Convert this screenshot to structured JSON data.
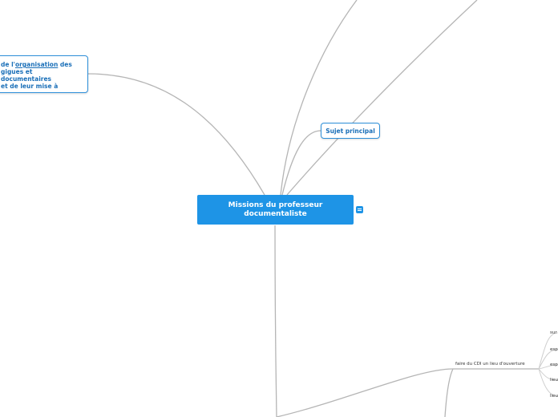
{
  "root": {
    "label_line1": "Missions du professeur",
    "label_line2": "documentaliste"
  },
  "left_node": {
    "line1_prefix": "de l'",
    "line1_link": "organisation",
    "line1_suffix": " des",
    "line2": "gigues et documentaires",
    "line3": "et de leur mise à"
  },
  "sujet": {
    "label": "Sujet principal"
  },
  "branch": {
    "label": "faire du CDI un lieu d'ouverture"
  },
  "leaves": [
    "sur",
    "esp",
    "esp",
    "lieu",
    "lieu"
  ],
  "colors": {
    "root": "#1e94e6",
    "border": "#2d8fd9",
    "link": "#b5b5b5"
  },
  "icons": {
    "notes": "notes-icon"
  }
}
